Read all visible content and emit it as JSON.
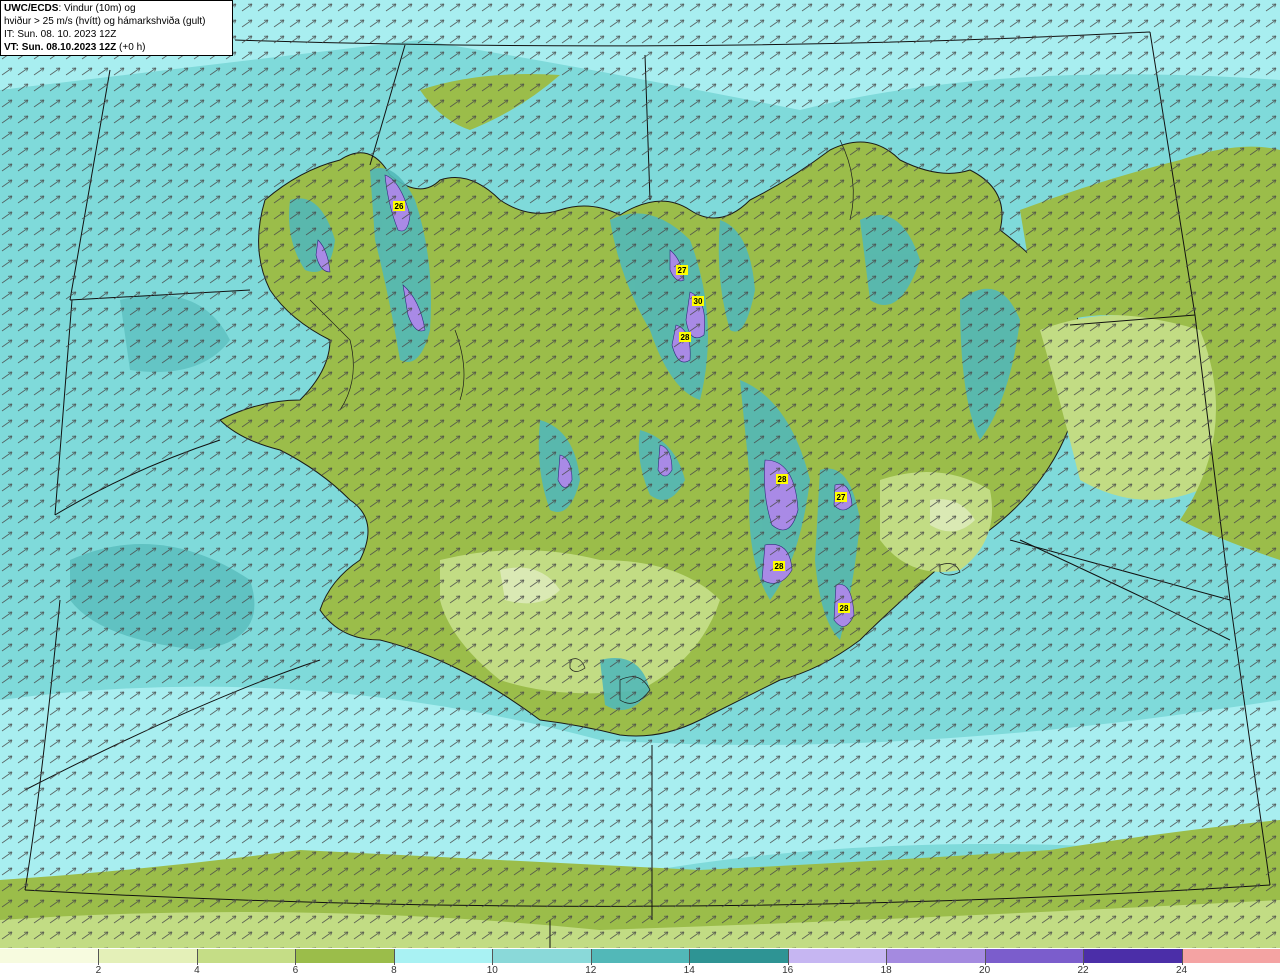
{
  "header": {
    "title_bold": "UWC/ECDS",
    "title_rest": ": Vindur (10m) og",
    "line2": "hviður > 25 m/s (hvítt) og hámarkshviða (gult)",
    "it_label": "IT: Sun. 08. 10. 2023 12Z",
    "vt_label_bold": "VT: Sun. 08.10.2023 12Z",
    "vt_suffix": " (+0 h)"
  },
  "colors": {
    "ocean": "#7fdada",
    "ocean_light": "#a8eef0",
    "land": "#9bbd4a",
    "land_light": "#c2dc84",
    "land_pale": "#e0ecc0",
    "mountain_teal": "#3fa8a8",
    "mountain_purple": "#a98ae6",
    "arrow": "#4a4a4a",
    "gust_label": "#ffff00"
  },
  "gusts": [
    {
      "id": "westfjords",
      "value": "26"
    },
    {
      "id": "north-1",
      "value": "27"
    },
    {
      "id": "north-2",
      "value": "30"
    },
    {
      "id": "north-3",
      "value": "28"
    },
    {
      "id": "highlands-1",
      "value": "28"
    },
    {
      "id": "highlands-2",
      "value": "27"
    },
    {
      "id": "south-1",
      "value": "28"
    },
    {
      "id": "south-2",
      "value": "28"
    }
  ],
  "colorbar": {
    "labels": [
      "2",
      "4",
      "6",
      "8",
      "10",
      "12",
      "14",
      "16",
      "18",
      "20",
      "22",
      "24"
    ],
    "colors": [
      "#f7fbdf",
      "#e4f0b8",
      "#c5dd86",
      "#9bbd4a",
      "#a9f2f3",
      "#8ad9d9",
      "#52b8b8",
      "#2e9494",
      "#c6b6f2",
      "#a48ae0",
      "#7b5dcc",
      "#4b2ea8",
      "#f4a3a3"
    ]
  }
}
